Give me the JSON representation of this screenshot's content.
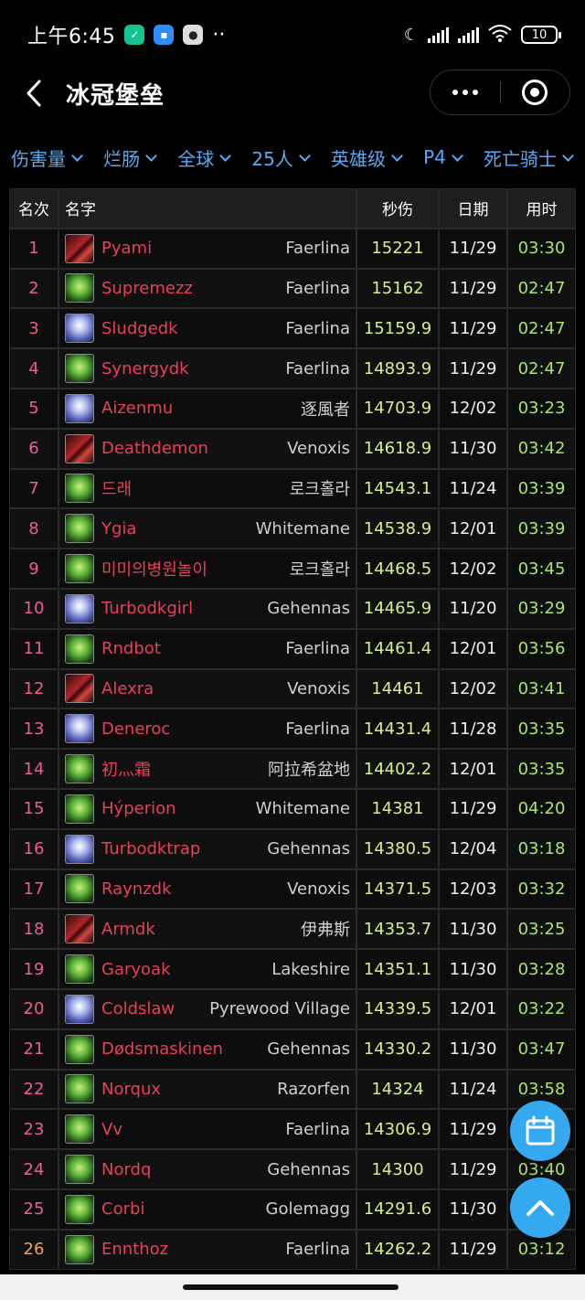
{
  "status_bar": {
    "time": "上午6:45",
    "battery": "10"
  },
  "header": {
    "title": "冰冠堡垒"
  },
  "filters": [
    {
      "label": "伤害量"
    },
    {
      "label": "烂肠"
    },
    {
      "label": "全球"
    },
    {
      "label": "25人"
    },
    {
      "label": "英雄级"
    },
    {
      "label": "P4"
    },
    {
      "label": "死亡骑士"
    }
  ],
  "table": {
    "columns": {
      "rank": "名次",
      "name": "名字",
      "dps": "秒伤",
      "date": "日期",
      "time": "用时"
    },
    "rows": [
      {
        "rank": "1",
        "spec": "blood",
        "name": "Pyami",
        "server": "Faerlina",
        "dps": "15221",
        "date": "11/29",
        "time": "03:30"
      },
      {
        "rank": "2",
        "spec": "unholy",
        "name": "Supremezz",
        "server": "Faerlina",
        "dps": "15162",
        "date": "11/29",
        "time": "02:47"
      },
      {
        "rank": "3",
        "spec": "frost",
        "name": "Sludgedk",
        "server": "Faerlina",
        "dps": "15159.9",
        "date": "11/29",
        "time": "02:47"
      },
      {
        "rank": "4",
        "spec": "unholy",
        "name": "Synergydk",
        "server": "Faerlina",
        "dps": "14893.9",
        "date": "11/29",
        "time": "02:47"
      },
      {
        "rank": "5",
        "spec": "frost",
        "name": "Aizenmu",
        "server": "逐風者",
        "dps": "14703.9",
        "date": "12/02",
        "time": "03:23"
      },
      {
        "rank": "6",
        "spec": "blood",
        "name": "Deathdemon",
        "server": "Venoxis",
        "dps": "14618.9",
        "date": "11/30",
        "time": "03:42"
      },
      {
        "rank": "7",
        "spec": "unholy",
        "name": "드래",
        "server": "로크홀라",
        "dps": "14543.1",
        "date": "11/24",
        "time": "03:39"
      },
      {
        "rank": "8",
        "spec": "unholy",
        "name": "Ygia",
        "server": "Whitemane",
        "dps": "14538.9",
        "date": "12/01",
        "time": "03:39"
      },
      {
        "rank": "9",
        "spec": "unholy",
        "name": "미미의병원놀이",
        "server": "로크홀라",
        "dps": "14468.5",
        "date": "12/02",
        "time": "03:45"
      },
      {
        "rank": "10",
        "spec": "frost",
        "name": "Turbodkgirl",
        "server": "Gehennas",
        "dps": "14465.9",
        "date": "11/20",
        "time": "03:29"
      },
      {
        "rank": "11",
        "spec": "unholy",
        "name": "Rndbot",
        "server": "Faerlina",
        "dps": "14461.4",
        "date": "12/01",
        "time": "03:56"
      },
      {
        "rank": "12",
        "spec": "blood",
        "name": "Alexra",
        "server": "Venoxis",
        "dps": "14461",
        "date": "12/02",
        "time": "03:41"
      },
      {
        "rank": "13",
        "spec": "frost",
        "name": "Deneroc",
        "server": "Faerlina",
        "dps": "14431.4",
        "date": "11/28",
        "time": "03:35"
      },
      {
        "rank": "14",
        "spec": "unholy",
        "name": "初灬霜",
        "server": "阿拉希盆地",
        "dps": "14402.2",
        "date": "12/01",
        "time": "03:35"
      },
      {
        "rank": "15",
        "spec": "unholy",
        "name": "Hýperion",
        "server": "Whitemane",
        "dps": "14381",
        "date": "11/29",
        "time": "04:20"
      },
      {
        "rank": "16",
        "spec": "frost",
        "name": "Turbodktrap",
        "server": "Gehennas",
        "dps": "14380.5",
        "date": "12/04",
        "time": "03:18"
      },
      {
        "rank": "17",
        "spec": "unholy",
        "name": "Raynzdk",
        "server": "Venoxis",
        "dps": "14371.5",
        "date": "12/03",
        "time": "03:32"
      },
      {
        "rank": "18",
        "spec": "blood",
        "name": "Armdk",
        "server": "伊弗斯",
        "dps": "14353.7",
        "date": "11/30",
        "time": "03:25"
      },
      {
        "rank": "19",
        "spec": "unholy",
        "name": "Garyoak",
        "server": "Lakeshire",
        "dps": "14351.1",
        "date": "11/30",
        "time": "03:28"
      },
      {
        "rank": "20",
        "spec": "frost",
        "name": "Coldslaw",
        "server": "Pyrewood Village",
        "dps": "14339.5",
        "date": "12/01",
        "time": "03:22"
      },
      {
        "rank": "21",
        "spec": "unholy",
        "name": "Dødsmaskinen",
        "server": "Gehennas",
        "dps": "14330.2",
        "date": "11/30",
        "time": "03:47"
      },
      {
        "rank": "22",
        "spec": "unholy",
        "name": "Norqux",
        "server": "Razorfen",
        "dps": "14324",
        "date": "11/24",
        "time": "03:58"
      },
      {
        "rank": "23",
        "spec": "unholy",
        "name": "Vv",
        "server": "Faerlina",
        "dps": "14306.9",
        "date": "11/29",
        "time": ""
      },
      {
        "rank": "24",
        "spec": "unholy",
        "name": "Nordq",
        "server": "Gehennas",
        "dps": "14300",
        "date": "11/29",
        "time": "03:40"
      },
      {
        "rank": "25",
        "spec": "unholy",
        "name": "Corbi",
        "server": "Golemagg",
        "dps": "14291.6",
        "date": "11/30",
        "time": ""
      },
      {
        "rank": "26",
        "spec": "unholy",
        "name": "Ennthoz",
        "server": "Faerlina",
        "dps": "14262.2",
        "date": "11/29",
        "time": "03:12"
      }
    ]
  },
  "colors": {
    "accent": "#5aa9f5",
    "player": "#e8405a",
    "rank": "#ef5a9a",
    "dps": "#d2f08c",
    "duration": "#a6e66e",
    "fab": "#35a9f0"
  },
  "icons": {
    "back": "chevron-left-icon",
    "more": "more-dots-icon",
    "close": "target-close-icon",
    "calendar": "calendar-icon",
    "scroll_top": "chevron-up-icon"
  }
}
